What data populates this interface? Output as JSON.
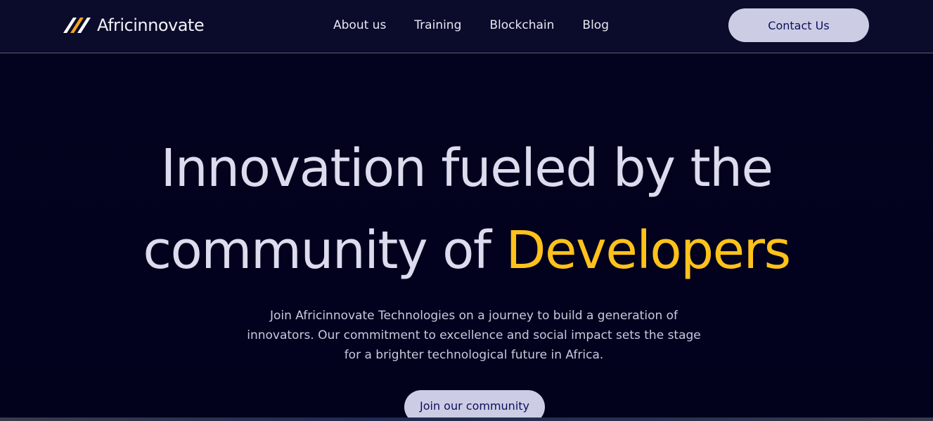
{
  "brand": {
    "name": "Africinnovate",
    "colors": {
      "accent": "#ffc21a",
      "background": "#03031f",
      "button": "#cccde4",
      "button_text": "#0e0f5c"
    }
  },
  "nav": {
    "links": [
      {
        "label": "About us"
      },
      {
        "label": "Training"
      },
      {
        "label": "Blockchain"
      },
      {
        "label": "Blog"
      }
    ],
    "cta_label": "Contact Us"
  },
  "hero": {
    "title_line1": "Innovation fueled by the",
    "title_line2_prefix": "community of",
    "title_highlight": "Developers",
    "description": "Join Africinnovate Technologies on a journey to build a generation of innovators. Our commitment to excellence and social impact sets the stage for a brighter technological future in Africa.",
    "cta_label": "Join our community"
  }
}
